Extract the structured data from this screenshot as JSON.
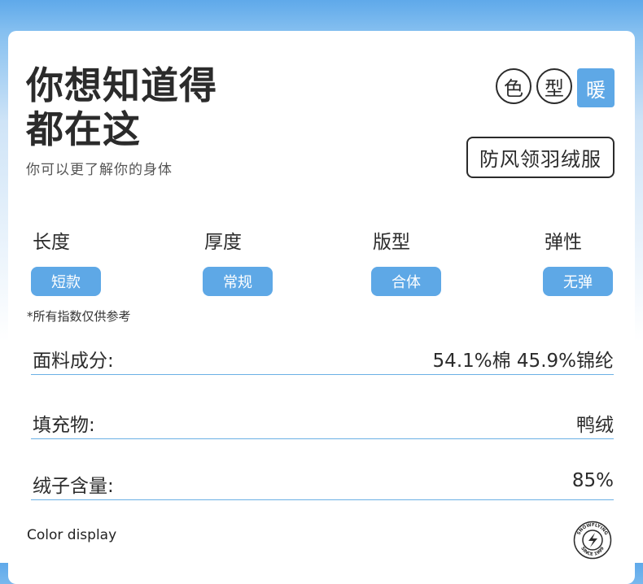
{
  "header": {
    "title_line1": "你想知道得",
    "title_line2": "都在这",
    "subtitle": "你可以更了解你的身体"
  },
  "tags": [
    {
      "label": "色",
      "active": false
    },
    {
      "label": "型",
      "active": false
    },
    {
      "label": "暖",
      "active": true
    }
  ],
  "product_name": "防风领羽绒服",
  "attributes": [
    {
      "label": "长度",
      "value": "短款"
    },
    {
      "label": "厚度",
      "value": "常规"
    },
    {
      "label": "版型",
      "value": "合体"
    },
    {
      "label": "弹性",
      "value": "无弹"
    }
  ],
  "note": "*所有指数仅供参考",
  "specs": [
    {
      "key": "面料成分:",
      "value": "54.1%棉 45.9%锦纶"
    },
    {
      "key": "填充物:",
      "value": "鸭绒"
    },
    {
      "key": "绒子含量:",
      "value": "85%"
    }
  ],
  "footer": {
    "color_display": "Color display",
    "logo_top_text": "SNOWFLYING",
    "logo_bottom_text": "SINCE 1999"
  },
  "colors": {
    "accent": "#5ea8e6",
    "header_gradient_top": "#5fa9ea",
    "divider": "#6bb0e5",
    "text": "#2b2b2b"
  }
}
